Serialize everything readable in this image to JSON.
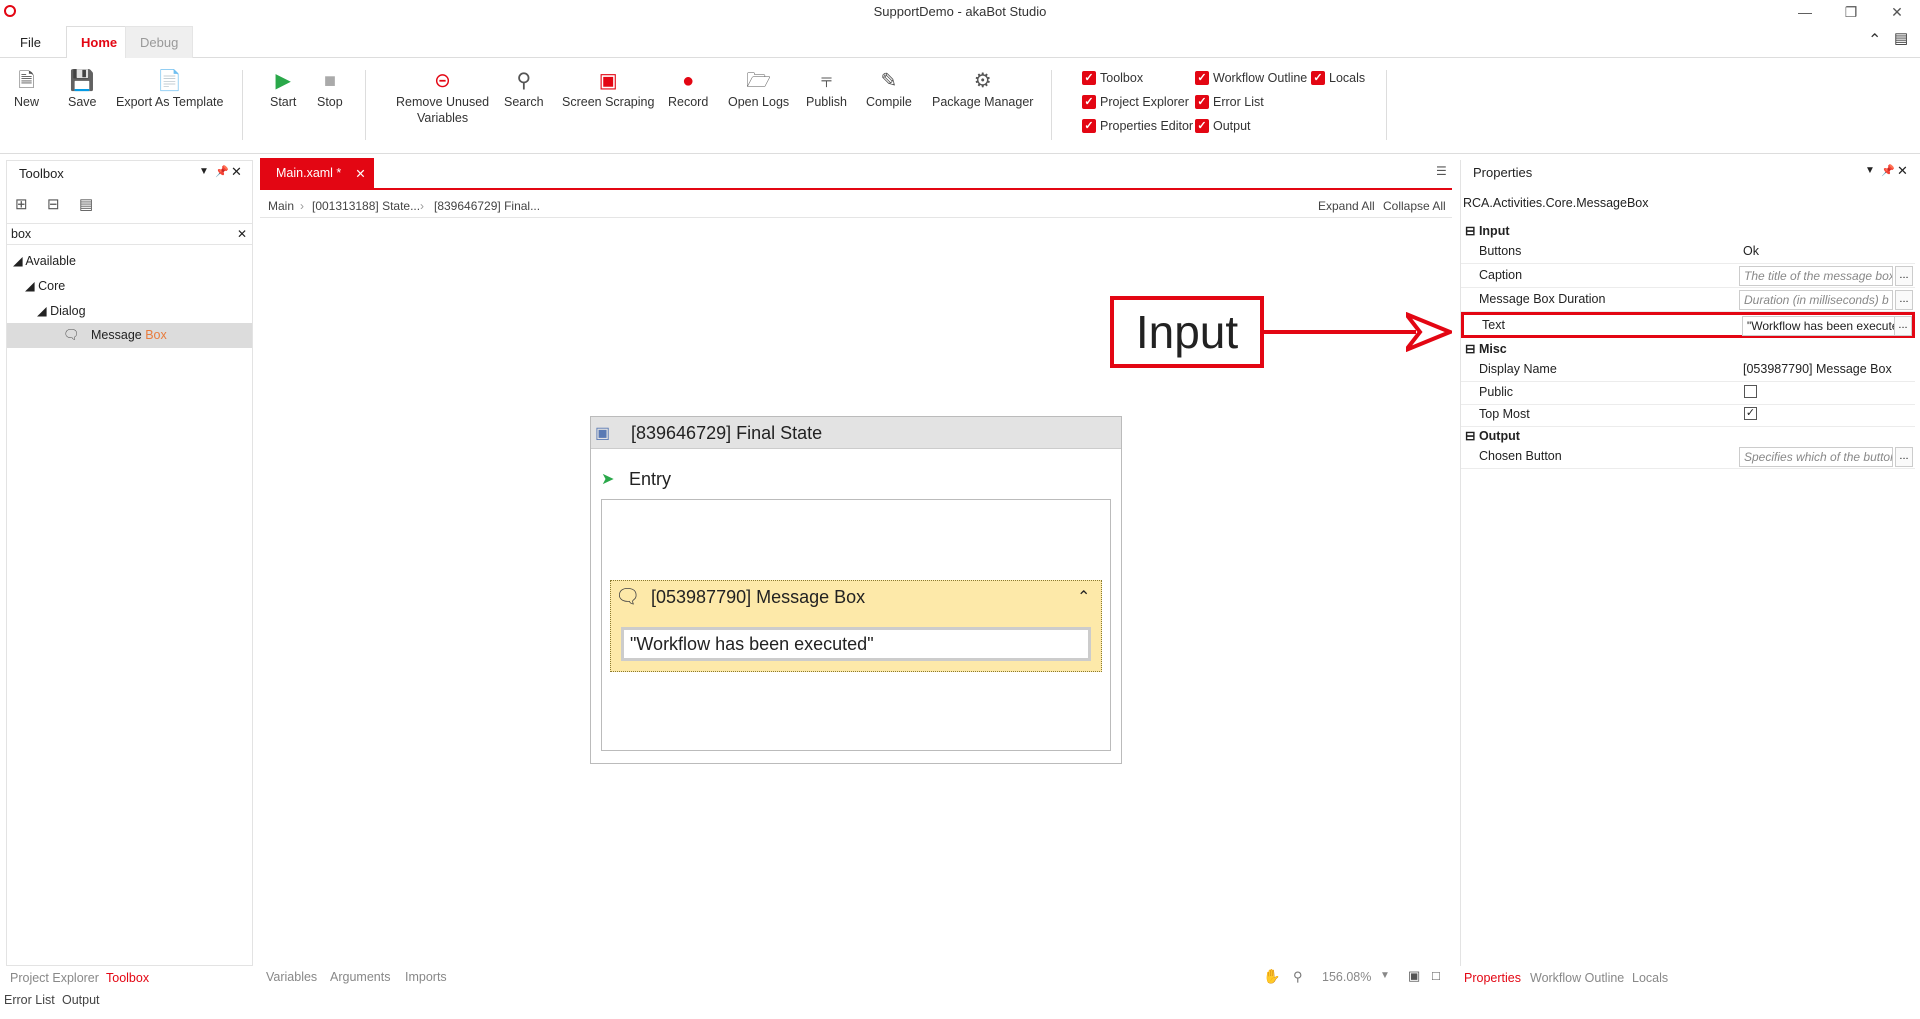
{
  "app": {
    "title": "SupportDemo - akaBot Studio"
  },
  "tabs": {
    "file": "File",
    "home": "Home",
    "debug": "Debug"
  },
  "ribbon": {
    "new": "New",
    "save": "Save",
    "export": "Export As Template",
    "start": "Start",
    "stop": "Stop",
    "remove_unused_1": "Remove Unused",
    "remove_unused_2": "Variables",
    "search": "Search",
    "screen_scraping": "Screen Scraping",
    "record": "Record",
    "open_logs": "Open Logs",
    "publish": "Publish",
    "compile": "Compile",
    "package_manager": "Package Manager",
    "checks": {
      "toolbox": "Toolbox",
      "workflow_outline": "Workflow Outline",
      "locals": "Locals",
      "project_explorer": "Project Explorer",
      "error_list": "Error List",
      "properties_editor": "Properties Editor",
      "output": "Output"
    }
  },
  "toolbox": {
    "title": "Toolbox",
    "search_value": "box",
    "tree": {
      "available": "Available",
      "core": "Core",
      "dialog": "Dialog",
      "item_prefix": "Message ",
      "item_match": "Box"
    }
  },
  "editor": {
    "tab": "Main.xaml *",
    "breadcrumb": {
      "main": "Main",
      "b1": "[001313188] State...",
      "b2": "[839646729] Final..."
    },
    "expand_all": "Expand All",
    "collapse_all": "Collapse All",
    "state_title": "[839646729] Final State",
    "entry": "Entry",
    "msgbox_title": "[053987790] Message Box",
    "msgbox_text": "\"Workflow has been executed\"",
    "annotation": "Input",
    "bottom": {
      "variables": "Variables",
      "arguments": "Arguments",
      "imports": "Imports",
      "zoom": "156.08%"
    }
  },
  "properties": {
    "title": "Properties",
    "type": "RCA.Activities.Core.MessageBox",
    "sections": {
      "input": "Input",
      "misc": "Misc",
      "output": "Output"
    },
    "buttons_label": "Buttons",
    "buttons_value": "Ok",
    "caption_label": "Caption",
    "caption_ph": "The title of the message box",
    "duration_label": "Message Box Duration",
    "duration_ph": "Duration (in milliseconds) b",
    "text_label": "Text",
    "text_value": "\"Workflow has been executed\"",
    "display_name_label": "Display Name",
    "display_name_value": "[053987790] Message Box",
    "public_label": "Public",
    "top_most_label": "Top Most",
    "chosen_button_label": "Chosen Button",
    "chosen_button_ph": "Specifies which of the button"
  },
  "bottom_tabs": {
    "project_explorer": "Project Explorer",
    "toolbox": "Toolbox",
    "error_list": "Error List",
    "output": "Output",
    "properties": "Properties",
    "workflow_outline": "Workflow Outline",
    "locals": "Locals"
  },
  "colors": {
    "accent": "#e30613",
    "msgbox_bg": "#fde9a9"
  }
}
